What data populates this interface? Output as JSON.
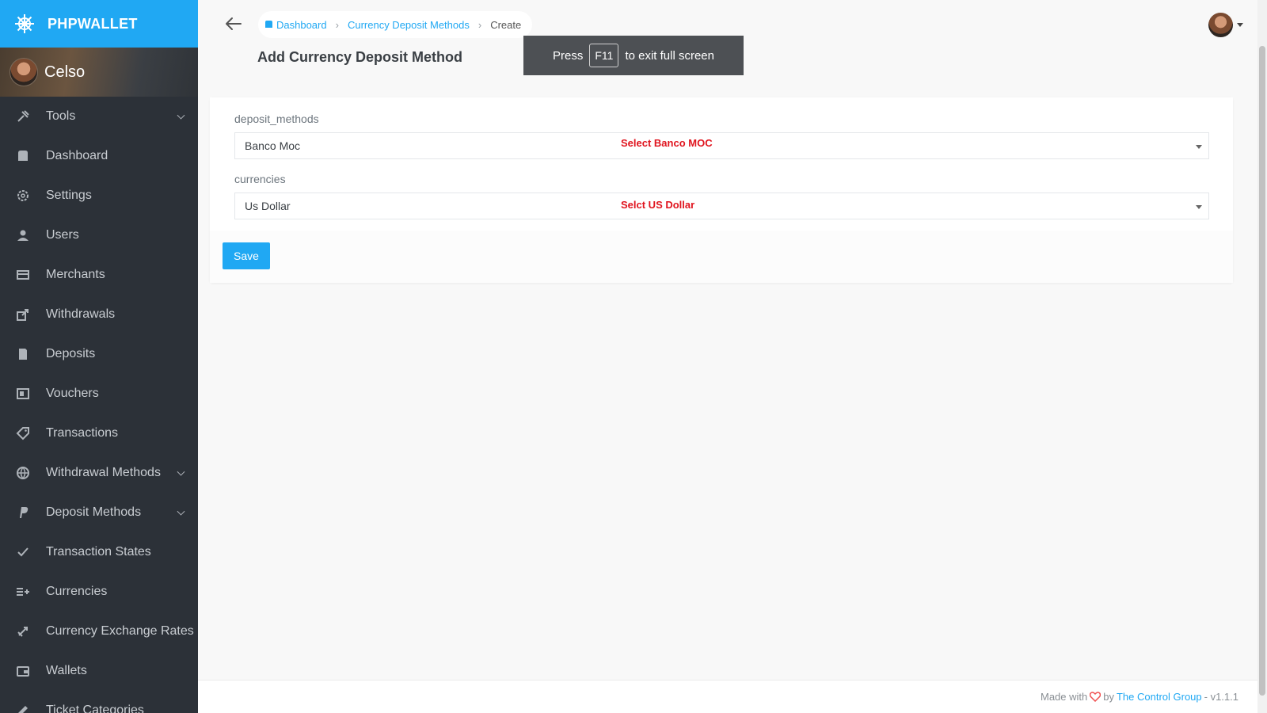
{
  "brand": {
    "name": "PHPWALLET",
    "icon": "helm-icon"
  },
  "user": {
    "name": "Celso"
  },
  "sidebar": {
    "items": [
      {
        "label": "Tools",
        "icon": "tools-icon",
        "has_submenu": true
      },
      {
        "label": "Dashboard",
        "icon": "dashboard-icon",
        "has_submenu": false
      },
      {
        "label": "Settings",
        "icon": "gear-icon",
        "has_submenu": false
      },
      {
        "label": "Users",
        "icon": "user-icon",
        "has_submenu": false
      },
      {
        "label": "Merchants",
        "icon": "card-icon",
        "has_submenu": false
      },
      {
        "label": "Withdrawals",
        "icon": "share-icon",
        "has_submenu": false
      },
      {
        "label": "Deposits",
        "icon": "book-icon",
        "has_submenu": false
      },
      {
        "label": "Vouchers",
        "icon": "voucher-icon",
        "has_submenu": false
      },
      {
        "label": "Transactions",
        "icon": "tag-icon",
        "has_submenu": false
      },
      {
        "label": "Withdrawal Methods",
        "icon": "globe-icon",
        "has_submenu": true
      },
      {
        "label": "Deposit Methods",
        "icon": "paypal-icon",
        "has_submenu": true
      },
      {
        "label": "Transaction States",
        "icon": "check-icon",
        "has_submenu": false
      },
      {
        "label": "Currencies",
        "icon": "list-add-icon",
        "has_submenu": false
      },
      {
        "label": "Currency Exchange Rates",
        "icon": "rocket-icon",
        "has_submenu": false
      },
      {
        "label": "Wallets",
        "icon": "wallet-icon",
        "has_submenu": false
      },
      {
        "label": "Ticket Categories",
        "icon": "ticket-icon",
        "has_submenu": false
      }
    ]
  },
  "breadcrumb": {
    "items": [
      {
        "label": "Dashboard",
        "link": true
      },
      {
        "label": "Currency Deposit Methods",
        "link": true
      },
      {
        "label": "Create",
        "link": false
      }
    ]
  },
  "page": {
    "title": "Add Currency Deposit Method"
  },
  "fullscreen_notice": {
    "prefix": "Press",
    "key": "F11",
    "suffix": "to exit full screen"
  },
  "form": {
    "deposit_methods": {
      "label": "deposit_methods",
      "value": "Banco Moc",
      "annotation": "Select Banco MOC"
    },
    "currencies": {
      "label": "currencies",
      "value": "Us Dollar",
      "annotation": "Selct US Dollar"
    },
    "save_label": "Save"
  },
  "footer": {
    "made_with": "Made with",
    "by": "by",
    "company": "The Control Group",
    "version": "- v1.1.1"
  },
  "colors": {
    "accent": "#20a8f3",
    "sidebar_bg": "#2c3138",
    "annotation": "#e0141e"
  }
}
